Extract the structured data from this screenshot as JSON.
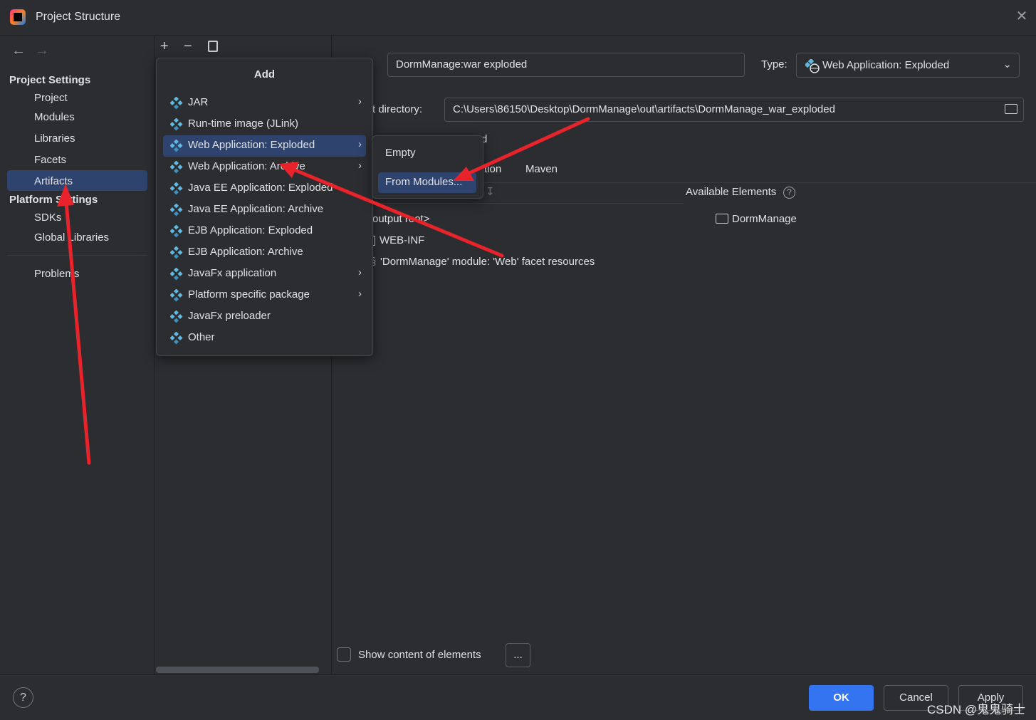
{
  "window": {
    "title": "Project Structure"
  },
  "sidebar": {
    "project_settings_header": "Project Settings",
    "project_items": [
      "Project",
      "Modules",
      "Libraries",
      "Facets",
      "Artifacts"
    ],
    "platform_settings_header": "Platform Settings",
    "platform_items": [
      "SDKs",
      "Global Libraries"
    ],
    "problems": "Problems",
    "selected": "Artifacts"
  },
  "artifact": {
    "name_value": "DormManage:war exploded",
    "type_label": "Type:",
    "type_value": "Web Application: Exploded",
    "output_dir_label": "t directory:",
    "output_dir_value": "C:\\Users\\86150\\Desktop\\DormManage\\out\\artifacts\\DormManage_war_exploded",
    "tab_partial": "tion",
    "tab_maven": "Maven",
    "available_elements_label": "Available Elements",
    "available_tree": [
      "DormManage"
    ],
    "output_tree": [
      "output root>",
      "WEB-INF",
      "'DormManage' module: 'Web' facet resources"
    ],
    "show_content_label": "Show content of elements",
    "ellipsis_button": "..."
  },
  "add_menu": {
    "title": "Add",
    "items": [
      {
        "label": "JAR",
        "submenu": true
      },
      {
        "label": "Run-time image (JLink)",
        "submenu": false
      },
      {
        "label": "Web Application: Exploded",
        "submenu": true,
        "selected": true
      },
      {
        "label": "Web Application: Archive",
        "submenu": true
      },
      {
        "label": "Java EE Application: Exploded",
        "submenu": false
      },
      {
        "label": "Java EE Application: Archive",
        "submenu": false
      },
      {
        "label": "EJB Application: Exploded",
        "submenu": false
      },
      {
        "label": "EJB Application: Archive",
        "submenu": false
      },
      {
        "label": "JavaFx application",
        "submenu": true
      },
      {
        "label": "Platform specific package",
        "submenu": true
      },
      {
        "label": "JavaFx preloader",
        "submenu": false
      },
      {
        "label": "Other",
        "submenu": false
      }
    ]
  },
  "sub_menu": {
    "items": [
      "Empty",
      "From Modules..."
    ],
    "selected": "From Modules..."
  },
  "buttons": {
    "ok": "OK",
    "cancel": "Cancel",
    "apply": "Apply",
    "help": "?"
  },
  "watermark": "CSDN @鬼鬼骑士",
  "colors": {
    "accent": "#3574f0",
    "selection": "#2e436e",
    "annotation_arrow": "#e8232b",
    "background": "#2b2d30"
  }
}
